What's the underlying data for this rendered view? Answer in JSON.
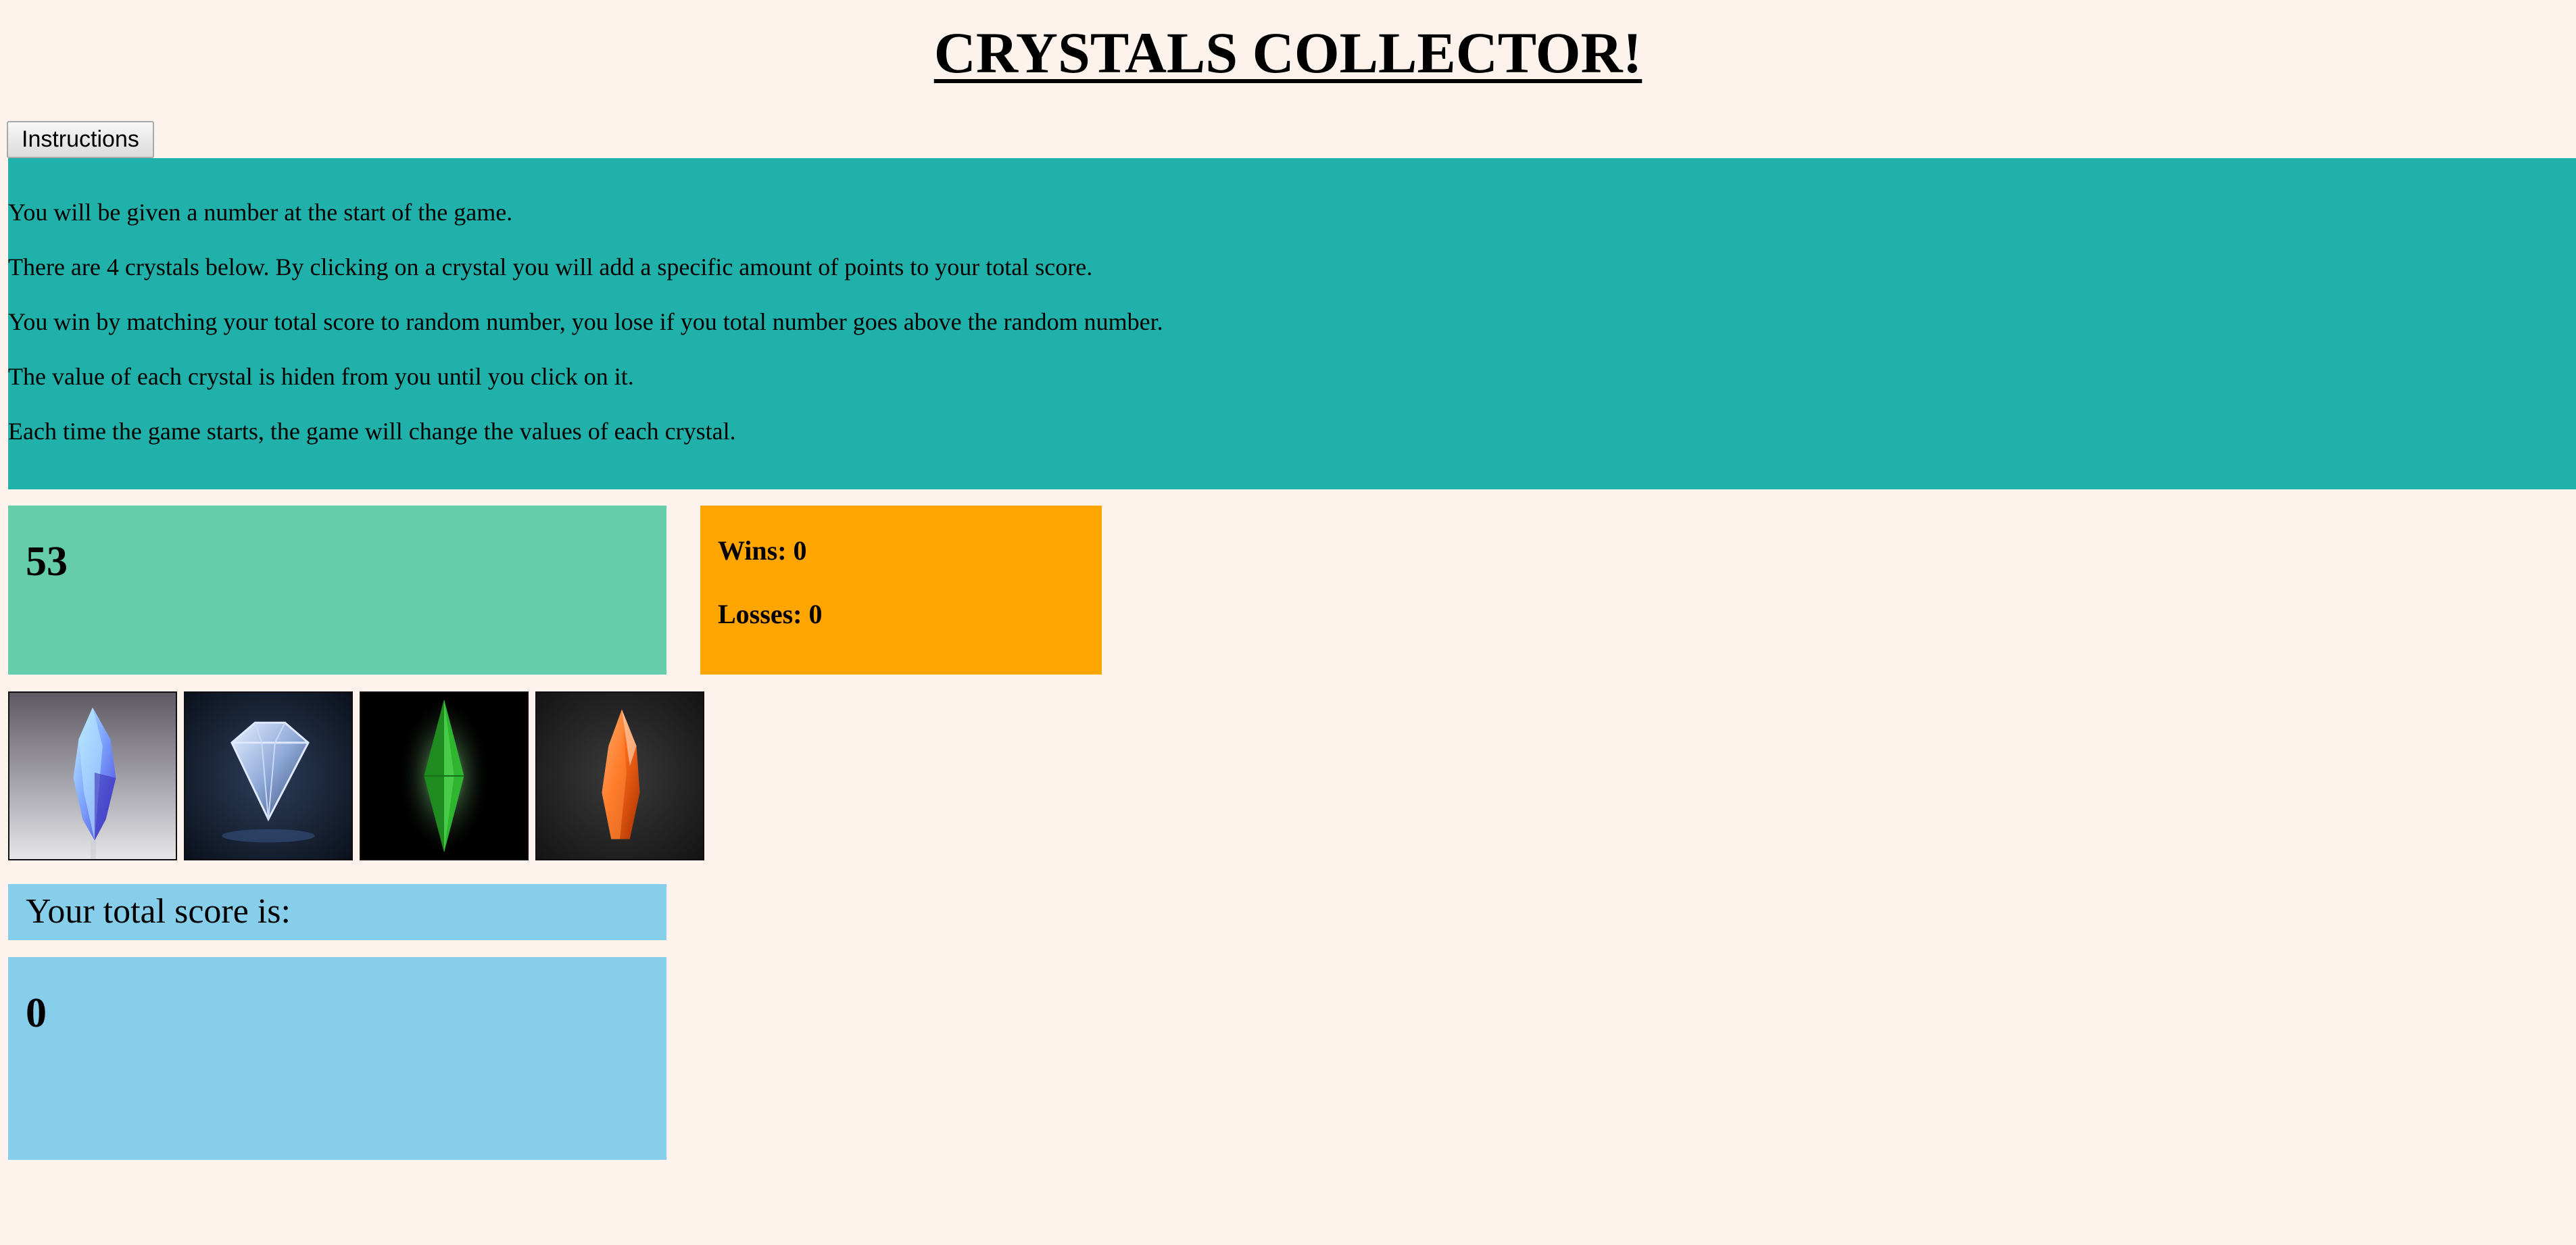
{
  "header": {
    "title": "CRYSTALS COLLECTOR!"
  },
  "instructions": {
    "button_label": "Instructions",
    "lines": [
      "You will be given a number at the start of the game.",
      "There are 4 crystals below. By clicking on a crystal you will add a specific amount of points to your total score.",
      "You win by matching your total score to random number, you lose if you total number goes above the random number.",
      "The value of each crystal is hiden from you until you click on it.",
      "Each time the game starts, the game will change the values of each crystal."
    ]
  },
  "game": {
    "target_number": "53",
    "wins_text": "Wins: 0",
    "losses_text": "Losses: 0",
    "total_score_label": "Your total score is:",
    "total_score": "0"
  },
  "crystals": [
    {
      "icon": "blue-crystal-icon",
      "color": "#6f7ff0"
    },
    {
      "icon": "diamond-icon",
      "color": "#9fb4d8"
    },
    {
      "icon": "green-gem-icon",
      "color": "#2fb52f"
    },
    {
      "icon": "orange-crystal-icon",
      "color": "#ff6a1a"
    }
  ],
  "colors": {
    "background": "#fdf3ec",
    "instructions_panel": "#20b2aa",
    "target_box": "#66cdaa",
    "stats_box": "#ffa500",
    "score_boxes": "#87ceeb"
  }
}
